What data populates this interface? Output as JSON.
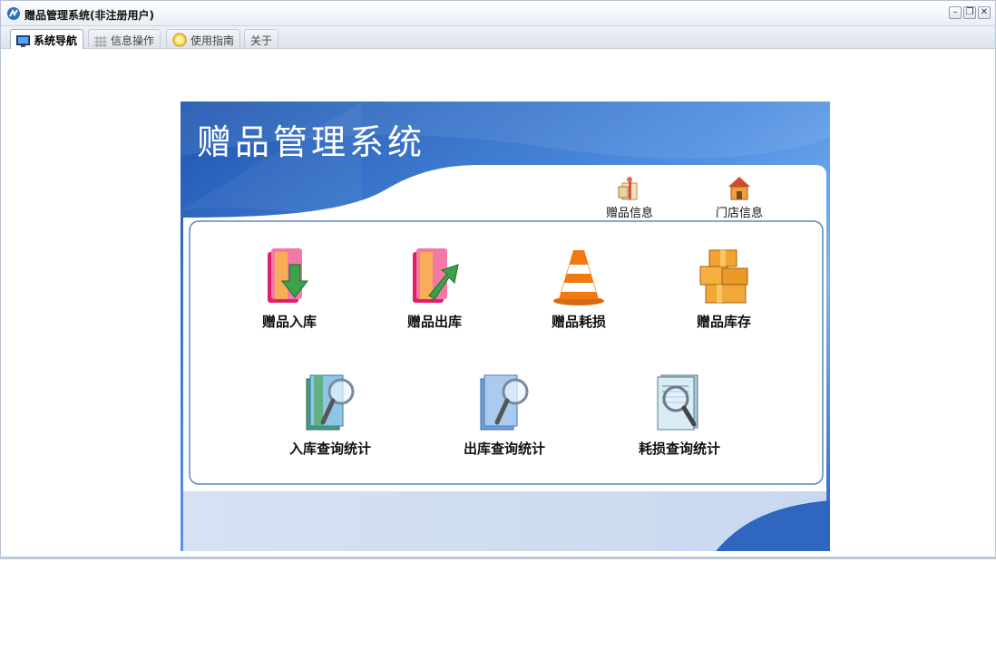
{
  "window": {
    "title": "赠品管理系统(非注册用户)",
    "controls": {
      "minimize": "–",
      "restore": "❐",
      "close": "✕"
    }
  },
  "tabs": [
    {
      "label": "系统导航",
      "icon": "monitor-icon",
      "active": true
    },
    {
      "label": "信息操作",
      "icon": "grid-icon",
      "active": false
    },
    {
      "label": "使用指南",
      "icon": "lightbulb-icon",
      "active": false
    },
    {
      "label": "关于",
      "icon": "",
      "active": false
    }
  ],
  "banner": {
    "title": "赠品管理系统"
  },
  "top_links": [
    {
      "label": "赠品信息",
      "icon": "gift-info-icon"
    },
    {
      "label": "门店信息",
      "icon": "store-icon"
    }
  ],
  "menu_row1": [
    {
      "label": "赠品入库",
      "icon": "folder-in-icon"
    },
    {
      "label": "赠品出库",
      "icon": "folder-out-icon"
    },
    {
      "label": "赠品耗损",
      "icon": "traffic-cone-icon"
    },
    {
      "label": "赠品库存",
      "icon": "boxes-icon"
    }
  ],
  "menu_row2": [
    {
      "label": "入库查询统计",
      "icon": "search-folder-green-icon"
    },
    {
      "label": "出库查询统计",
      "icon": "search-folder-blue-icon"
    },
    {
      "label": "耗损查询统计",
      "icon": "search-document-icon"
    }
  ],
  "colors": {
    "banner_dark": "#2a5fb8",
    "banner_light": "#6fa8ec",
    "frame_border": "#5c86c4",
    "footer": "#d4e0f2"
  }
}
